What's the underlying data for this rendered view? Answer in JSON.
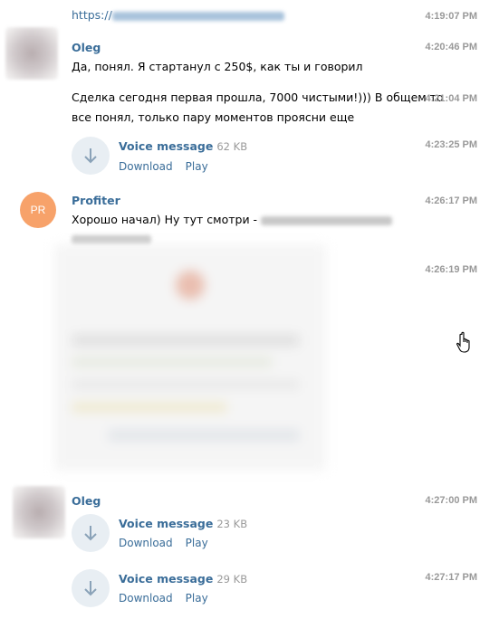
{
  "messages": {
    "m0": {
      "link_prefix": "https://",
      "time": "4:19:07 PM"
    },
    "m1": {
      "sender": "Oleg",
      "text": "Да, понял. Я стартанул с 250$, как ты и говорил",
      "time": "4:20:46 PM"
    },
    "m2": {
      "line1": "Сделка сегодня первая прошла, 7000 чистыми!))) В общем то",
      "line2": "все понял, только пару моментов проясни еще",
      "time": "4:21:04 PM"
    },
    "m3": {
      "title": "Voice message",
      "size": "62 KB",
      "download": "Download",
      "play": "Play",
      "time": "4:23:25 PM"
    },
    "m4": {
      "avatar_initials": "PR",
      "sender": "Profiter",
      "text": "Хорошо начал) Ну тут смотри - ",
      "time": "4:26:17 PM"
    },
    "m5": {
      "time": "4:26:19 PM"
    },
    "m6": {
      "sender": "Oleg",
      "title": "Voice message",
      "size": "23 KB",
      "download": "Download",
      "play": "Play",
      "time": "4:27:00 PM"
    },
    "m7": {
      "title": "Voice message",
      "size": "29 KB",
      "download": "Download",
      "play": "Play",
      "time": "4:27:17 PM"
    }
  },
  "colors": {
    "accent": "#3a6d99",
    "avatar_pr": "#f7a26a",
    "time": "#999999",
    "voice_bg": "#e8eef3",
    "icon": "#8aa2b8"
  },
  "icons": {
    "voice": "download-arrow-icon",
    "cursor": "hand-pointer-icon"
  }
}
